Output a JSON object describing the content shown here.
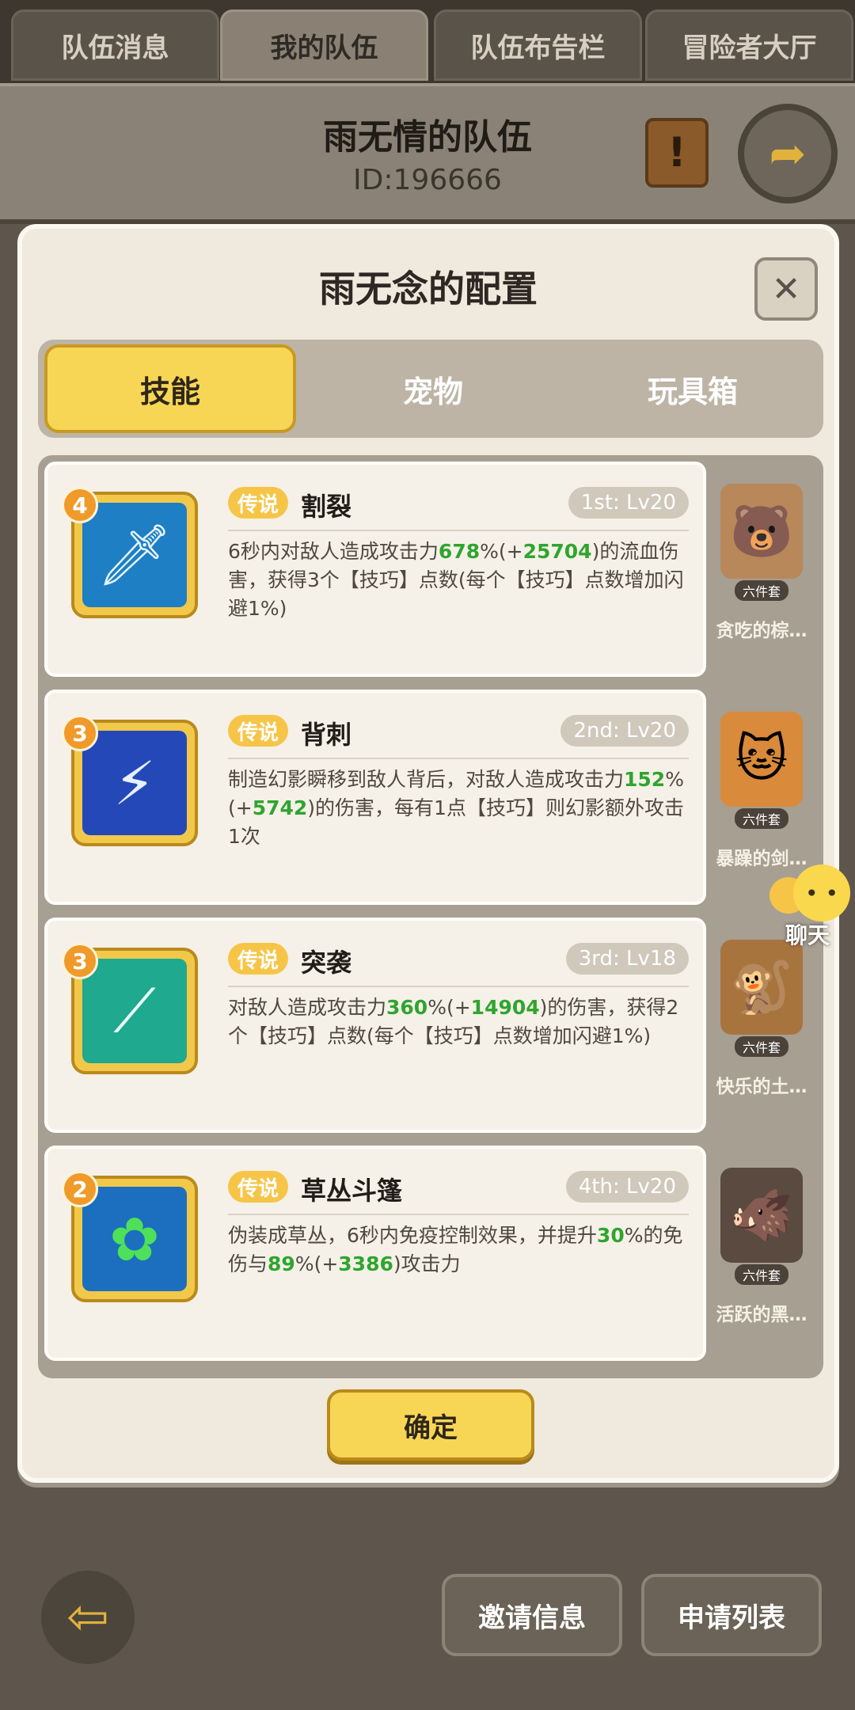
{
  "top_tabs": [
    {
      "label": "队伍消息"
    },
    {
      "label": "我的队伍"
    },
    {
      "label": "队伍布告栏"
    },
    {
      "label": "冒险者大厅"
    }
  ],
  "team": {
    "name": "雨无情的队伍",
    "id_text": "ID:196666"
  },
  "modal": {
    "title": "雨无念的配置",
    "close_label": "✕",
    "tabs": [
      {
        "label": "技能"
      },
      {
        "label": "宠物"
      },
      {
        "label": "玩具箱"
      }
    ],
    "skills": [
      {
        "level": "4",
        "rarity": "传说",
        "name": "割裂",
        "rank": "1st: Lv20",
        "desc_parts": [
          {
            "t": "6秒内对敌人造成攻击力"
          },
          {
            "t": "678",
            "g": true
          },
          {
            "t": "%(+"
          },
          {
            "t": "25704",
            "g": true
          },
          {
            "t": ")的流血伤害，获得3个【技巧】点数(每个【技巧】点数增加闪避1%)"
          }
        ]
      },
      {
        "level": "3",
        "rarity": "传说",
        "name": "背刺",
        "rank": "2nd: Lv20",
        "desc_parts": [
          {
            "t": "制造幻影瞬移到敌人背后，对敌人造成攻击力"
          },
          {
            "t": "152",
            "g": true
          },
          {
            "t": "%(+"
          },
          {
            "t": "5742",
            "g": true
          },
          {
            "t": ")的伤害，每有1点【技巧】则幻影额外攻击1次"
          }
        ]
      },
      {
        "level": "3",
        "rarity": "传说",
        "name": "突袭",
        "rank": "3rd: Lv18",
        "desc_parts": [
          {
            "t": "对敌人造成攻击力"
          },
          {
            "t": "360",
            "g": true
          },
          {
            "t": "%(+"
          },
          {
            "t": "14904",
            "g": true
          },
          {
            "t": ")的伤害，获得2个【技巧】点数(每个【技巧】点数增加闪避1%)"
          }
        ]
      },
      {
        "level": "2",
        "rarity": "传说",
        "name": "草丛斗篷",
        "rank": "4th: Lv20",
        "desc_parts": [
          {
            "t": "伪装成草丛，6秒内免疫控制效果，并提升"
          },
          {
            "t": "30",
            "g": true
          },
          {
            "t": "%的免伤与"
          },
          {
            "t": "89",
            "g": true
          },
          {
            "t": "%(+"
          },
          {
            "t": "3386",
            "g": true
          },
          {
            "t": ")攻击力"
          }
        ]
      }
    ],
    "pets": [
      {
        "name": "贪吃的棕…",
        "tag": "六件套"
      },
      {
        "name": "暴躁的剑…",
        "tag": "六件套"
      },
      {
        "name": "快乐的土…",
        "tag": "六件套"
      },
      {
        "name": "活跃的黑…",
        "tag": "六件套"
      }
    ],
    "confirm_label": "确定"
  },
  "chat": {
    "label": "聊天"
  },
  "bottom": {
    "invite_label": "邀请信息",
    "apply_label": "申请列表"
  }
}
